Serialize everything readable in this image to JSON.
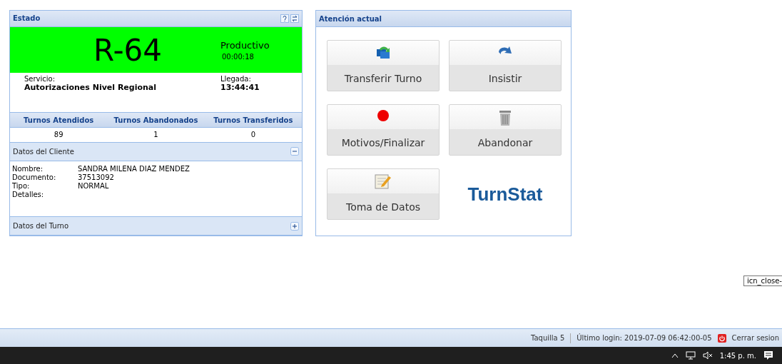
{
  "estado": {
    "title": "Estado",
    "turn": "R-64",
    "status": "Productivo",
    "timer": "00:00:18",
    "service_label": "Servicio:",
    "service": "Autorizaciones Nivel Regional",
    "arrival_label": "Llegada:",
    "arrival": "13:44:41"
  },
  "stats": {
    "columns": [
      "Turnos Atendidos",
      "Turnos Abandonados",
      "Turnos Transferidos"
    ],
    "values": [
      "89",
      "1",
      "0"
    ]
  },
  "sections": [
    {
      "title": "Datos del Cliente",
      "expanded": true,
      "fields": [
        {
          "label": "Nombre:",
          "value": "SANDRA MILENA DIAZ MENDEZ"
        },
        {
          "label": "Documento:",
          "value": "37513092"
        },
        {
          "label": "Tipo:",
          "value": "NORMAL"
        },
        {
          "label": "Detalles:"
        }
      ]
    },
    {
      "title": "Datos del Turno",
      "expanded": false
    }
  ],
  "atencion": {
    "title": "Atención actual",
    "buttons": [
      {
        "kind": "transfer",
        "label": "Transferir Turno"
      },
      {
        "kind": "redo",
        "label": "Insistir"
      },
      {
        "kind": "record",
        "label": "Motivos/Finalizar"
      },
      {
        "kind": "trash",
        "label": "Abandonar"
      },
      {
        "kind": "notes",
        "label": "Toma de Datos"
      }
    ],
    "logo": "TurnStat"
  },
  "tooltip": "icn_close-",
  "status_bar": {
    "desk": "Taquilla 5",
    "login": "Último login: 2019-07-09 06:42:00-05",
    "logout": "Cerrar sesion"
  },
  "taskbar": {
    "time": "1:45 p. m."
  }
}
